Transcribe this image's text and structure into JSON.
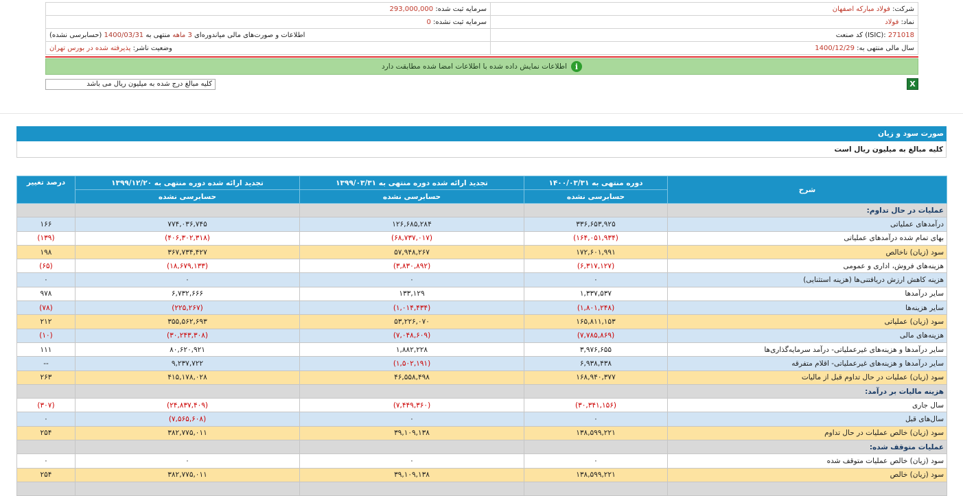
{
  "company": {
    "company_label": "شرکت:",
    "company_value": "فولاد مبارکه اصفهان",
    "reg_capital_label": "سرمایه ثبت شده:",
    "reg_capital_value": "293,000,000",
    "symbol_label": "نماد:",
    "symbol_value": "فولاد",
    "unreg_capital_label": "سرمایه ثبت نشده:",
    "unreg_capital_value": "0",
    "isic_label": "کد صنعت (ISIC):",
    "isic_value": "271018",
    "report_desc_pre": "اطلاعات و صورت‌های مالی میاندوره‌ای",
    "report_period": "3 ماهه",
    "report_desc_mid": "منتهی به",
    "report_date": "1400/03/31",
    "report_audit": "(حسابرسی نشده)",
    "fy_label": "سال مالی منتهی به:",
    "fy_value": "1400/12/29",
    "status_label": "وضعیت ناشر:",
    "status_value": "پذیرفته شده در بورس تهران"
  },
  "notice": {
    "text": "اطلاعات نمایش داده شده با اطلاعات امضا شده مطابقت دارد",
    "icon": "info-icon",
    "color": "#a9d99b"
  },
  "excel": {
    "icon": "excel-export-icon",
    "glyph": "X"
  },
  "units_select": {
    "value": "کلیه مبالغ درج شده به میلیون ریال می باشد"
  },
  "section": {
    "title": "صورت سود و زیان",
    "units": "کلیه مبالغ به میلیون ریال است"
  },
  "table": {
    "headers": {
      "desc": "شرح",
      "c1": "دوره منتهی به ۱۴۰۰/۰۳/۳۱",
      "c2": "تجدید ارائه شده دوره منتهی به ۱۳۹۹/۰۳/۳۱",
      "c3": "تجدید ارائه شده دوره منتهی به ۱۳۹۹/۱۲/۲۰",
      "c4": "درصد تغییر",
      "c1_sub": "حسابرسی نشده",
      "c2_sub": "حسابرسی نشده",
      "c3_sub": "حسابرسی نشده"
    },
    "rows": [
      {
        "t": "sect",
        "d": "عملیات در حال تداوم:",
        "c1": "",
        "c2": "",
        "c3": "",
        "c4": ""
      },
      {
        "t": "blue",
        "d": "درآمدهای عملیاتی",
        "c1": "۳۳۶,۶۵۳,۹۲۵",
        "c2": "۱۲۶,۶۸۵,۲۸۴",
        "c3": "۷۷۴,۰۳۶,۷۴۵",
        "c4": "۱۶۶"
      },
      {
        "t": "white",
        "d": "بهای تمام شده درآمدهای عملیاتی",
        "c1": "(۱۶۴,۰۵۱,۹۳۴)",
        "c2": "(۶۸,۷۳۷,۰۱۷)",
        "c3": "(۴۰۶,۳۰۲,۳۱۸)",
        "c4": "(۱۳۹)"
      },
      {
        "t": "gold",
        "d": "سود (زیان) ناخالص",
        "c1": "۱۷۲,۶۰۱,۹۹۱",
        "c2": "۵۷,۹۴۸,۲۶۷",
        "c3": "۳۶۷,۷۳۴,۴۲۷",
        "c4": "۱۹۸"
      },
      {
        "t": "white",
        "d": "هزینه‌های فروش، اداری و عمومی",
        "c1": "(۶,۳۱۷,۱۲۷)",
        "c2": "(۳,۸۳۰,۸۹۲)",
        "c3": "(۱۸,۶۷۹,۱۳۳)",
        "c4": "(۶۵)"
      },
      {
        "t": "blue",
        "d": "هزینه کاهش ارزش دریافتنی‌ها (هزینه استثنایی)",
        "c1": "۰",
        "c2": "۰",
        "c3": "۰",
        "c4": "۰"
      },
      {
        "t": "white",
        "d": "سایر درآمدها",
        "c1": "۱,۳۳۷,۵۳۷",
        "c2": "۱۳۳,۱۲۹",
        "c3": "۶,۷۳۲,۶۶۶",
        "c4": "۹۷۸"
      },
      {
        "t": "blue",
        "d": "سایر هزینه‌ها",
        "c1": "(۱,۸۰۱,۲۴۸)",
        "c2": "(۱,۰۱۴,۴۳۴)",
        "c3": "(۲۲۵,۲۶۷)",
        "c4": "(۷۸)"
      },
      {
        "t": "gold",
        "d": "سود (زیان) عملیاتی",
        "c1": "۱۶۵,۸۱۱,۱۵۳",
        "c2": "۵۳,۲۲۶,۰۷۰",
        "c3": "۳۵۵,۵۶۲,۶۹۳",
        "c4": "۲۱۲"
      },
      {
        "t": "blue",
        "d": "هزینه‌های مالی",
        "c1": "(۷,۷۸۵,۸۶۹)",
        "c2": "(۷,۰۴۸,۶۰۹)",
        "c3": "(۳۰,۲۴۳,۳۰۸)",
        "c4": "(۱۰)"
      },
      {
        "t": "white",
        "d": "سایر درآمدها و هزینه‌های غیرعملیاتی- درآمد سرمایه‌گذاری‌ها",
        "c1": "۳,۹۷۶,۶۵۵",
        "c2": "۱,۸۸۲,۲۲۸",
        "c3": "۸۰,۶۲۰,۹۲۱",
        "c4": "۱۱۱"
      },
      {
        "t": "blue",
        "d": "سایر درآمدها و هزینه‌های غیرعملیاتی- اقلام متفرقه",
        "c1": "۶,۹۳۸,۴۳۸",
        "c2": "(۱,۵۰۲,۱۹۱)",
        "c3": "۹,۲۳۷,۷۲۲",
        "c4": "--"
      },
      {
        "t": "gold",
        "d": "سود (زیان) عملیات در حال تداوم قبل از مالیات",
        "c1": "۱۶۸,۹۴۰,۳۷۷",
        "c2": "۴۶,۵۵۸,۴۹۸",
        "c3": "۴۱۵,۱۷۸,۰۲۸",
        "c4": "۲۶۳"
      },
      {
        "t": "sect",
        "d": "هزینه مالیات بر درآمد:",
        "c1": "",
        "c2": "",
        "c3": "",
        "c4": ""
      },
      {
        "t": "white",
        "d": "سال جاری",
        "c1": "(۳۰,۳۴۱,۱۵۶)",
        "c2": "(۷,۴۴۹,۳۶۰)",
        "c3": "(۲۴,۸۳۷,۴۰۹)",
        "c4": "(۳۰۷)"
      },
      {
        "t": "blue",
        "d": "سال‌های قبل",
        "c1": "۰",
        "c2": "۰",
        "c3": "(۷,۵۶۵,۶۰۸)",
        "c4": "۰"
      },
      {
        "t": "gold",
        "d": "سود (زیان) خالص عملیات در حال تداوم",
        "c1": "۱۳۸,۵۹۹,۲۲۱",
        "c2": "۳۹,۱۰۹,۱۳۸",
        "c3": "۳۸۲,۷۷۵,۰۱۱",
        "c4": "۲۵۴"
      },
      {
        "t": "sect",
        "d": "عملیات متوقف شده:",
        "c1": "",
        "c2": "",
        "c3": "",
        "c4": ""
      },
      {
        "t": "white",
        "d": "سود (زیان) خالص عملیات متوقف شده",
        "c1": "۰",
        "c2": "۰",
        "c3": "۰",
        "c4": "۰"
      },
      {
        "t": "gold",
        "d": "سود (زیان) خالص",
        "c1": "۱۳۸,۵۹۹,۲۲۱",
        "c2": "۳۹,۱۰۹,۱۳۸",
        "c3": "۳۸۲,۷۷۵,۰۱۱",
        "c4": "۲۵۴"
      },
      {
        "t": "sect",
        "d": "",
        "c1": "",
        "c2": "",
        "c3": "",
        "c4": ""
      }
    ]
  }
}
